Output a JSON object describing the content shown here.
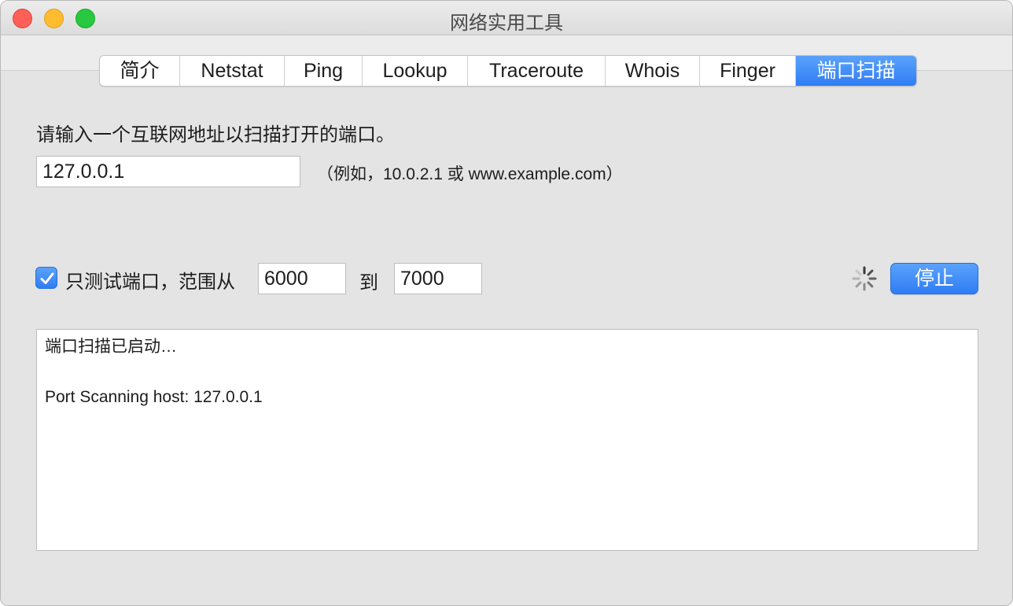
{
  "window": {
    "title": "网络实用工具"
  },
  "tabs": [
    {
      "label": "简介",
      "active": false
    },
    {
      "label": "Netstat",
      "active": false
    },
    {
      "label": "Ping",
      "active": false
    },
    {
      "label": "Lookup",
      "active": false
    },
    {
      "label": "Traceroute",
      "active": false
    },
    {
      "label": "Whois",
      "active": false
    },
    {
      "label": "Finger",
      "active": false
    },
    {
      "label": "端口扫描",
      "active": true
    }
  ],
  "form": {
    "prompt": "请输入一个互联网地址以扫描打开的端口。",
    "host_value": "127.0.0.1",
    "hint": "（例如，10.0.2.1 或 www.example.com）",
    "range_checkbox_checked": true,
    "range_label": "只测试端口，范围从",
    "range_from": "6000",
    "to_label": "到",
    "range_to": "7000",
    "stop_label": "停止"
  },
  "output": {
    "lines": [
      "端口扫描已启动…",
      "",
      "Port Scanning host: 127.0.0.1"
    ]
  },
  "colors": {
    "accent": "#2f7df4",
    "close": "#fe5f57",
    "minimize": "#febc2e",
    "maximize": "#28c840"
  }
}
